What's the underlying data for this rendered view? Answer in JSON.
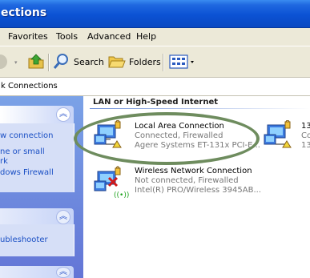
{
  "window": {
    "title": "ections"
  },
  "menu": [
    {
      "label": "Favorites",
      "key": "a"
    },
    {
      "label": "Tools",
      "key": "T"
    },
    {
      "label": "Advanced",
      "key": "n"
    },
    {
      "label": "Help",
      "key": "H"
    }
  ],
  "toolbar": {
    "search": "Search",
    "folders": "Folders"
  },
  "address": {
    "text": "k Connections"
  },
  "tasks": {
    "panel1": [
      "w connection",
      "ne or small",
      "rk",
      "dows Firewall"
    ],
    "panel2": [
      "ubleshooter"
    ]
  },
  "group": {
    "title": "LAN or High-Speed Internet"
  },
  "connections": [
    {
      "name": "Local Area Connection",
      "status": "Connected, Firewalled",
      "device": "Agere Systems ET-131x PCI-E..."
    },
    {
      "name": "Wireless Network Connection",
      "status": "Not connected, Firewalled",
      "device": "Intel(R) PRO/Wireless 3945AB..."
    },
    {
      "name": "13",
      "status": "Co",
      "device": "13"
    }
  ],
  "colors": {
    "highlight_ring": "#6e8c5e",
    "title_bar": "#0b52d4",
    "task_pane": "#6375d6"
  }
}
